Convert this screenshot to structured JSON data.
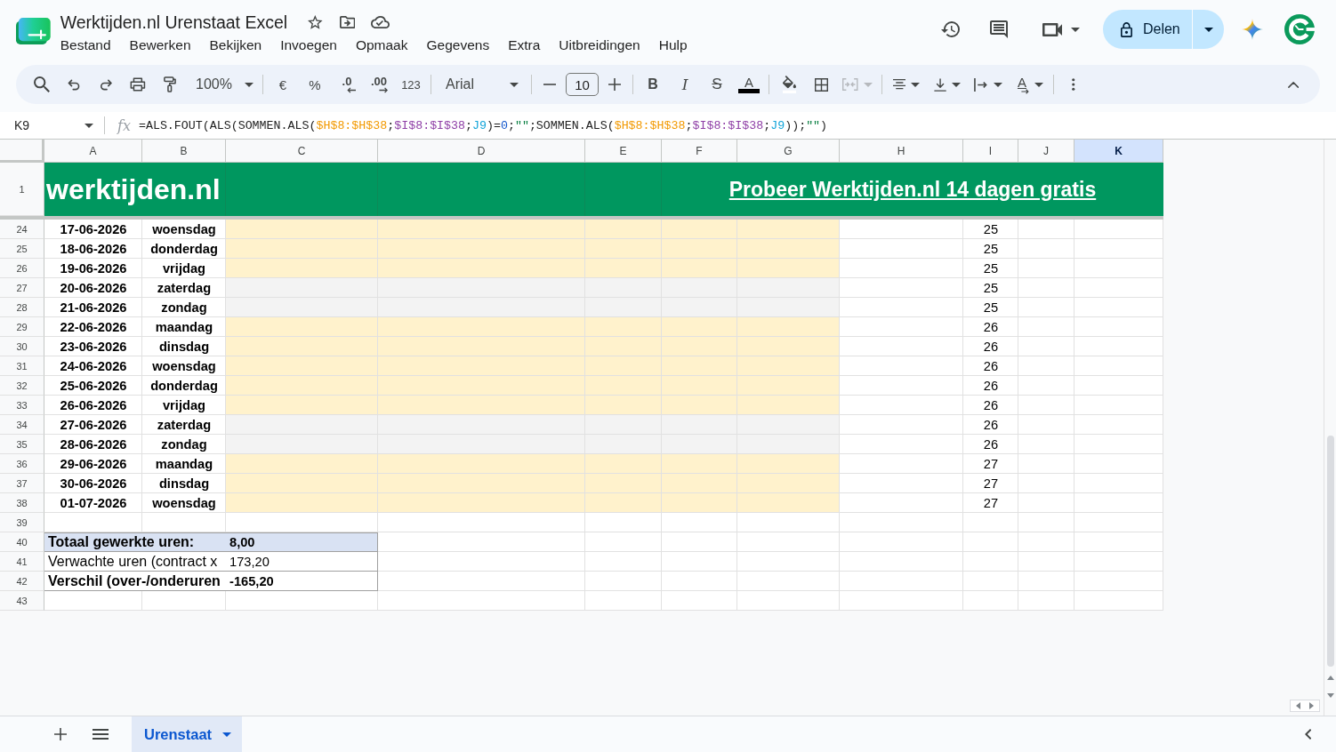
{
  "window": {
    "title": "Werktijden.nl Urenstaat Excel"
  },
  "menu": [
    "Bestand",
    "Bewerken",
    "Bekijken",
    "Invoegen",
    "Opmaak",
    "Gegevens",
    "Extra",
    "Uitbreidingen",
    "Hulp"
  ],
  "share_button": {
    "label": "Delen"
  },
  "toolbar": {
    "zoom": "100%",
    "currency": "€",
    "percent": "%",
    "decrease_decimals": ".0",
    "increase_decimals": ".00",
    "number_format": "123",
    "font": "Arial",
    "font_size": "10",
    "bold": "B",
    "italic": "I",
    "strikethrough": "S",
    "text_color": "A",
    "merge_cells": {
      "disabled": true
    },
    "text_rotation": "A"
  },
  "formula_bar": {
    "cell_reference": "K9",
    "function_label": "fx",
    "formula": [
      {
        "text": "=ALS.FOUT(ALS(SOMMEN.ALS("
      },
      {
        "text": "$H$8:$H$38",
        "color": "#f29900"
      },
      {
        "text": ";"
      },
      {
        "text": "$I$8:$I$38",
        "color": "#8e3fa6"
      },
      {
        "text": ";"
      },
      {
        "text": "J9",
        "color": "#12a4d9"
      },
      {
        "text": ")="
      },
      {
        "text": "0",
        "color": "#1155cc"
      },
      {
        "text": ";"
      },
      {
        "text": "\"\"",
        "color": "#0b8043"
      },
      {
        "text": ";SOMMEN.ALS("
      },
      {
        "text": "$H$8:$H$38",
        "color": "#f29900"
      },
      {
        "text": ";"
      },
      {
        "text": "$I$8:$I$38",
        "color": "#8e3fa6"
      },
      {
        "text": ";"
      },
      {
        "text": "J9",
        "color": "#12a4d9"
      },
      {
        "text": "));"
      },
      {
        "text": "\"\"",
        "color": "#0b8043"
      },
      {
        "text": ")"
      }
    ]
  },
  "sheet": {
    "columns": [
      {
        "label": "A",
        "selected": false
      },
      {
        "label": "B",
        "selected": false
      },
      {
        "label": "C",
        "selected": false
      },
      {
        "label": "D",
        "selected": false
      },
      {
        "label": "E",
        "selected": false
      },
      {
        "label": "F",
        "selected": false
      },
      {
        "label": "G",
        "selected": false
      },
      {
        "label": "H",
        "selected": false
      },
      {
        "label": "I",
        "selected": false
      },
      {
        "label": "J",
        "selected": false
      },
      {
        "label": "K",
        "selected": true
      }
    ],
    "banner": {
      "row": "1",
      "logo": "werktijden.nl",
      "link": "Probeer Werktijden.nl 14 dagen gratis"
    },
    "rows": [
      {
        "kind": "day",
        "row": "24",
        "date": "17-06-2026",
        "day": "woensdag",
        "weekend": false,
        "week": "25"
      },
      {
        "kind": "day",
        "row": "25",
        "date": "18-06-2026",
        "day": "donderdag",
        "weekend": false,
        "week": "25"
      },
      {
        "kind": "day",
        "row": "26",
        "date": "19-06-2026",
        "day": "vrijdag",
        "weekend": false,
        "week": "25"
      },
      {
        "kind": "day",
        "row": "27",
        "date": "20-06-2026",
        "day": "zaterdag",
        "weekend": true,
        "week": "25"
      },
      {
        "kind": "day",
        "row": "28",
        "date": "21-06-2026",
        "day": "zondag",
        "weekend": true,
        "week": "25"
      },
      {
        "kind": "day",
        "row": "29",
        "date": "22-06-2026",
        "day": "maandag",
        "weekend": false,
        "week": "26"
      },
      {
        "kind": "day",
        "row": "30",
        "date": "23-06-2026",
        "day": "dinsdag",
        "weekend": false,
        "week": "26"
      },
      {
        "kind": "day",
        "row": "31",
        "date": "24-06-2026",
        "day": "woensdag",
        "weekend": false,
        "week": "26"
      },
      {
        "kind": "day",
        "row": "32",
        "date": "25-06-2026",
        "day": "donderdag",
        "weekend": false,
        "week": "26"
      },
      {
        "kind": "day",
        "row": "33",
        "date": "26-06-2026",
        "day": "vrijdag",
        "weekend": false,
        "week": "26"
      },
      {
        "kind": "day",
        "row": "34",
        "date": "27-06-2026",
        "day": "zaterdag",
        "weekend": true,
        "week": "26"
      },
      {
        "kind": "day",
        "row": "35",
        "date": "28-06-2026",
        "day": "zondag",
        "weekend": true,
        "week": "26"
      },
      {
        "kind": "day",
        "row": "36",
        "date": "29-06-2026",
        "day": "maandag",
        "weekend": false,
        "week": "27"
      },
      {
        "kind": "day",
        "row": "37",
        "date": "30-06-2026",
        "day": "dinsdag",
        "weekend": false,
        "week": "27"
      },
      {
        "kind": "day",
        "row": "38",
        "date": "01-07-2026",
        "day": "woensdag",
        "weekend": false,
        "week": "27"
      },
      {
        "kind": "blank",
        "row": "39"
      },
      {
        "kind": "summary",
        "row": "40",
        "label": "Totaal gewerkte uren:",
        "value": "8,00",
        "bold": true,
        "highlighted": true
      },
      {
        "kind": "summary",
        "row": "41",
        "label": "Verwachte uren (contract x",
        "value": "173,20",
        "bold": false,
        "highlighted": false
      },
      {
        "kind": "summary",
        "row": "42",
        "label": "Verschil (over-/onderuren",
        "value": "-165,20",
        "bold": true,
        "highlighted": false
      },
      {
        "kind": "blank",
        "row": "43"
      }
    ]
  },
  "sheet_tabs": [
    {
      "label": "Urenstaat",
      "selected": true
    }
  ]
}
